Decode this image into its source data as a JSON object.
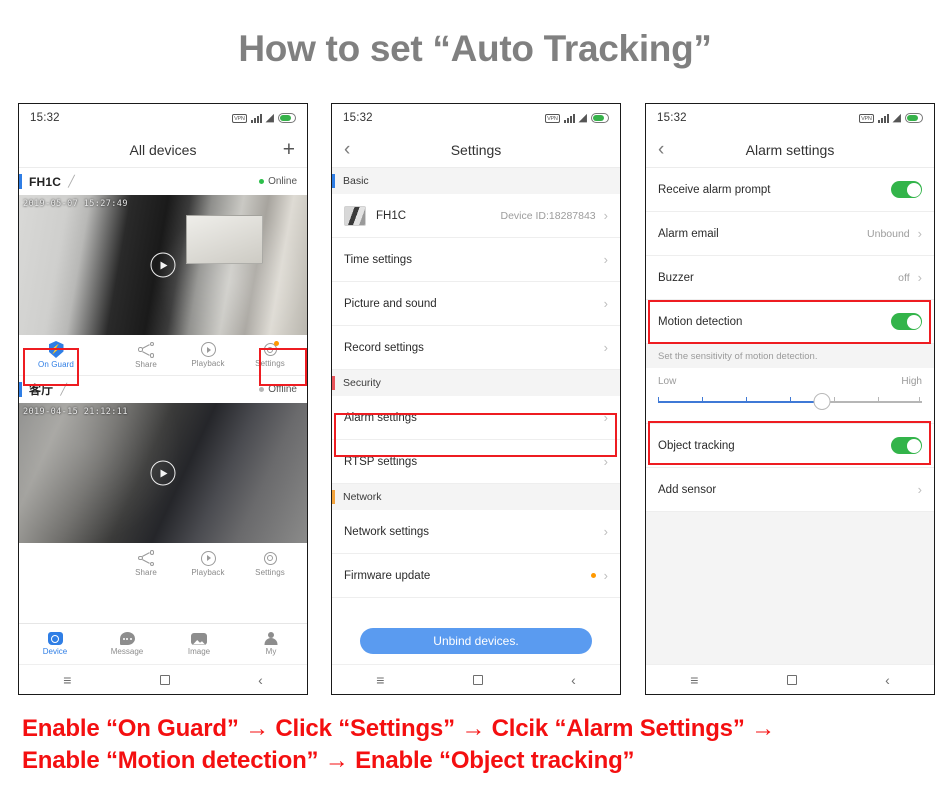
{
  "title": "How to set “Auto Tracking”",
  "caption_line1": "Enable “On Guard” → Click “Settings” → Clcik “Alarm Settings” →",
  "caption_line2": "Enable “Motion detection” → Enable “Object tracking”",
  "colors": {
    "title_gray": "#808080",
    "caption_red": "#f40f10",
    "highlight_red": "#ee1c21",
    "accent_blue": "#2f7ee5",
    "toggle_green": "#33b44a",
    "badge_orange": "#ff9900",
    "section_security": "#e8545a",
    "section_network": "#f2a33c"
  },
  "statusbar": {
    "time": "15:32",
    "icons": [
      "vpn-icon",
      "signal-icon",
      "wifi-icon",
      "battery-icon"
    ],
    "vpn_label": "VPN"
  },
  "navbar": {
    "menu": "≡",
    "home": "home-square-icon",
    "back": "‹"
  },
  "screen1": {
    "appbar": {
      "title": "All devices",
      "add": "+"
    },
    "devices": [
      {
        "name": "FH1C",
        "edit_icon": "pencil-icon",
        "status": "Online",
        "status_state": "online",
        "timestamp": "2019-05-07  15:27:49",
        "actions": [
          {
            "label": "On Guard",
            "icon": "shield-icon",
            "active": true,
            "highlighted": true
          },
          {
            "label": "Share",
            "icon": "share-icon",
            "active": false,
            "highlighted": false
          },
          {
            "label": "Playback",
            "icon": "playback-icon",
            "active": false,
            "highlighted": false
          },
          {
            "label": "Settings",
            "icon": "gear-icon",
            "active": false,
            "highlighted": true,
            "badge": true
          }
        ]
      },
      {
        "name": "客厅",
        "edit_icon": "pencil-icon",
        "status": "Offline",
        "status_state": "offline",
        "timestamp": "2019-04-15  21:12:11",
        "actions": [
          {
            "label": "Share",
            "icon": "share-icon"
          },
          {
            "label": "Playback",
            "icon": "playback-icon"
          },
          {
            "label": "Settings",
            "icon": "gear-icon"
          }
        ]
      }
    ],
    "tabs": [
      {
        "label": "Device",
        "icon": "camera-icon",
        "active": true
      },
      {
        "label": "Message",
        "icon": "message-icon",
        "active": false
      },
      {
        "label": "Image",
        "icon": "image-icon",
        "active": false
      },
      {
        "label": "My",
        "icon": "person-icon",
        "active": false
      }
    ]
  },
  "screen2": {
    "appbar": {
      "title": "Settings",
      "back": "‹"
    },
    "sections": [
      {
        "type": "header",
        "label": "Basic",
        "color_key": "accent_blue"
      },
      {
        "type": "device",
        "label": "FH1C",
        "value": "Device ID:18287843",
        "chevron": "›"
      },
      {
        "type": "row",
        "label": "Time settings",
        "chevron": "›"
      },
      {
        "type": "row",
        "label": "Picture and sound",
        "chevron": "›"
      },
      {
        "type": "row",
        "label": "Record settings",
        "chevron": "›"
      },
      {
        "type": "header",
        "label": "Security",
        "color_key": "section_security"
      },
      {
        "type": "row",
        "label": "Alarm settings",
        "chevron": "›",
        "highlighted": true
      },
      {
        "type": "row",
        "label": "RTSP settings",
        "chevron": "›"
      },
      {
        "type": "header",
        "label": "Network",
        "color_key": "section_network"
      },
      {
        "type": "row",
        "label": "Network settings",
        "chevron": "›"
      },
      {
        "type": "row",
        "label": "Firmware update",
        "chevron": "›",
        "badge": true
      }
    ],
    "unbind_button": "Unbind devices."
  },
  "screen3": {
    "appbar": {
      "title": "Alarm settings",
      "back": "‹"
    },
    "rows": [
      {
        "type": "toggle",
        "label": "Receive alarm prompt",
        "state": "on"
      },
      {
        "type": "value",
        "label": "Alarm email",
        "value": "Unbound",
        "chevron": "›"
      },
      {
        "type": "value",
        "label": "Buzzer",
        "value": "off",
        "chevron": "›"
      },
      {
        "type": "toggle",
        "label": "Motion detection",
        "state": "on",
        "highlighted": true
      }
    ],
    "sensitivity": {
      "hint": "Set the sensitivity of motion detection.",
      "low_label": "Low",
      "high_label": "High",
      "value_percent": 62
    },
    "rows_after": [
      {
        "type": "toggle",
        "label": "Object tracking",
        "state": "on",
        "highlighted": true
      },
      {
        "type": "value",
        "label": "Add sensor",
        "value": "",
        "chevron": "›"
      }
    ]
  }
}
